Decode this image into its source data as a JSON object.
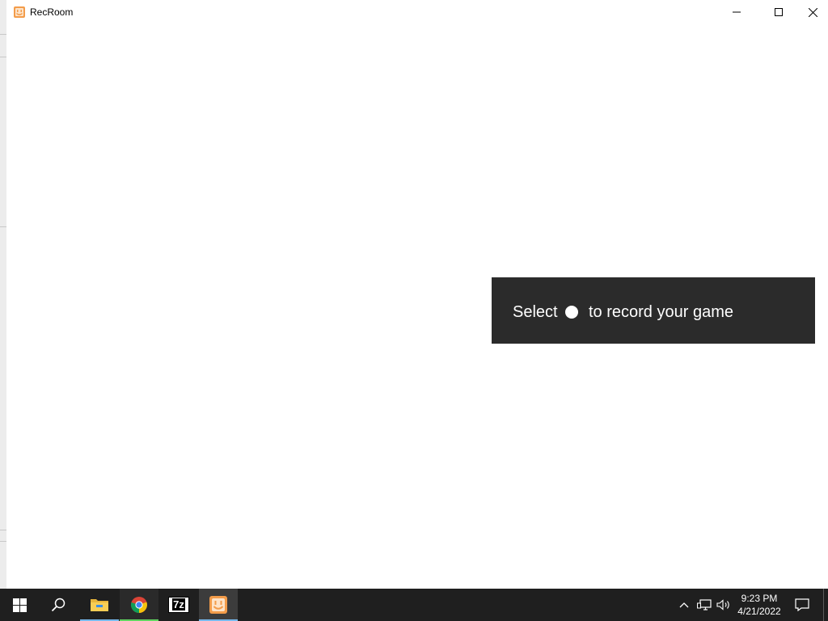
{
  "window": {
    "title": "RecRoom",
    "app_icon": "recroom-icon",
    "controls": {
      "minimize": "minimize-icon",
      "maximize": "maximize-icon",
      "close": "close-icon"
    }
  },
  "toast": {
    "text_before": "Select",
    "icon": "record-dot-icon",
    "text_after": "to record your game"
  },
  "taskbar": {
    "pinned": [
      {
        "name": "start-button",
        "icon": "windows-logo-icon",
        "active": false
      },
      {
        "name": "search-button",
        "icon": "search-icon",
        "active": false
      },
      {
        "name": "file-explorer",
        "icon": "folder-icon",
        "active": true
      },
      {
        "name": "chrome",
        "icon": "chrome-icon",
        "active": true
      },
      {
        "name": "7zip",
        "icon": "7zip-icon",
        "label": "7z",
        "active": false
      },
      {
        "name": "recroom",
        "icon": "recroom-icon",
        "active": true
      }
    ],
    "tray": {
      "icons": [
        "chevron-up-icon",
        "network-icon",
        "volume-icon",
        "notification-icon"
      ],
      "time": "9:23 PM",
      "date": "4/21/2022"
    }
  },
  "colors": {
    "toast_bg": "#2b2b2b",
    "taskbar_bg": "#1f1f1f",
    "accent": "#76b9ed",
    "chrome_indicator": "#5fd45f",
    "recroom_orange": "#f39c4a"
  }
}
